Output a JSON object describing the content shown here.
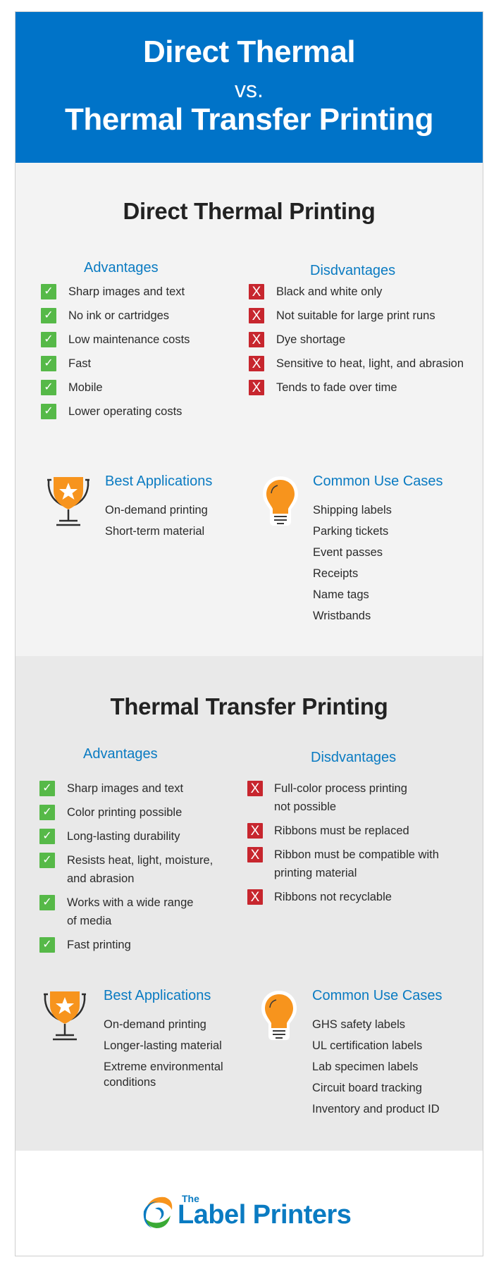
{
  "header": {
    "title_line1": "Direct Thermal",
    "vs": "vs.",
    "title_line2": "Thermal Transfer Printing",
    "bg_color": "#0073c8"
  },
  "direct_thermal": {
    "title": "Direct Thermal Printing",
    "advantages_label": "Advantages",
    "advantages": [
      "Sharp images and text",
      "No ink or cartridges",
      "Low maintenance costs",
      "Fast",
      "Mobile",
      "Lower operating costs"
    ],
    "disadvantages_label": "Disdvantages",
    "disadvantages": [
      "Black and white only",
      "Not suitable for large print runs",
      "Dye shortage",
      "Sensitive to heat, light, and abrasion",
      "Tends to fade over time"
    ],
    "best_applications_label": "Best Applications",
    "best_applications": [
      "On-demand printing",
      "Short-term material"
    ],
    "use_cases_label": "Common Use Cases",
    "use_cases": [
      "Shipping labels",
      "Parking tickets",
      "Event passes",
      "Receipts",
      "Name tags",
      "Wristbands"
    ]
  },
  "thermal_transfer": {
    "title": "Thermal Transfer Printing",
    "advantages_label": "Advantages",
    "advantages": [
      "Sharp images and text",
      "Color printing possible",
      "Long-lasting durability",
      "Resists heat, light, moisture, and abrasion",
      "Works with a wide range of media",
      "Fast printing"
    ],
    "disadvantages_label": "Disdvantages",
    "disadvantages": [
      "Full-color process printing not possible",
      "Ribbons must be replaced",
      "Ribbon must be compatible with printing material",
      "Ribbons not recyclable"
    ],
    "best_applications_label": "Best Applications",
    "best_applications": [
      "On-demand printing",
      "Longer-lasting material",
      "Extreme environmental conditions"
    ],
    "use_cases_label": "Common Use Cases",
    "use_cases": [
      "GHS safety labels",
      "UL certification labels",
      "Lab specimen labels",
      "Circuit board tracking",
      "Inventory and product ID"
    ]
  },
  "icons": {
    "check": "✓",
    "cross": "X",
    "advantage_icon": "check-icon",
    "disadvantage_icon": "x-icon",
    "best_applications_icon": "trophy-icon",
    "use_cases_icon": "lightbulb-icon"
  },
  "colors": {
    "accent_blue": "#0a7bc2",
    "check_green": "#56b948",
    "cross_red": "#c7262e",
    "icon_orange": "#f7941d"
  },
  "footer": {
    "logo_small": "The",
    "logo_name": "Label Printers"
  }
}
